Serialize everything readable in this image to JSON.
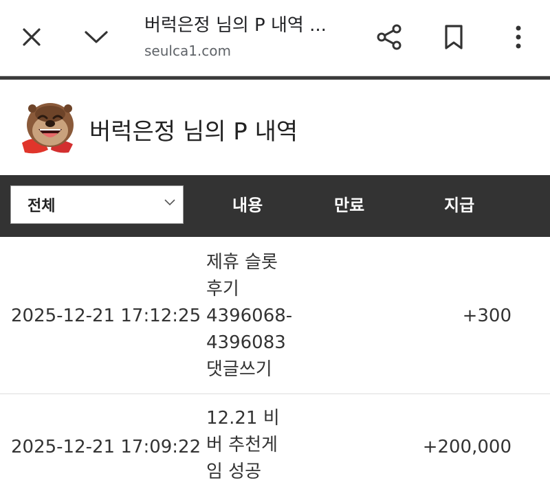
{
  "browser": {
    "title": "버럭은정 님의 P 내역 ...",
    "url": "seulca1.com",
    "icons": [
      "close-icon",
      "chevron-down-icon",
      "share-icon",
      "bookmark-icon",
      "more-vert-icon"
    ]
  },
  "profile": {
    "title": "버럭은정 님의 P 내역"
  },
  "filter": {
    "selected": "전체"
  },
  "columns": {
    "content": "내용",
    "expire": "만료",
    "pay": "지급"
  },
  "rows": [
    {
      "date": "2025-12-21 17:12:25",
      "content": [
        "제휴 슬롯",
        "후기",
        "4396068-",
        "4396083",
        "댓글쓰기"
      ],
      "expire": "",
      "amount": "+300"
    },
    {
      "date": "2025-12-21 17:09:22",
      "content": [
        "12.21 비",
        "버 추천게",
        "임 성공"
      ],
      "expire": "",
      "amount": "+200,000"
    }
  ],
  "colors": {
    "header_bg": "#333333",
    "divider": "#3c3c3c"
  }
}
